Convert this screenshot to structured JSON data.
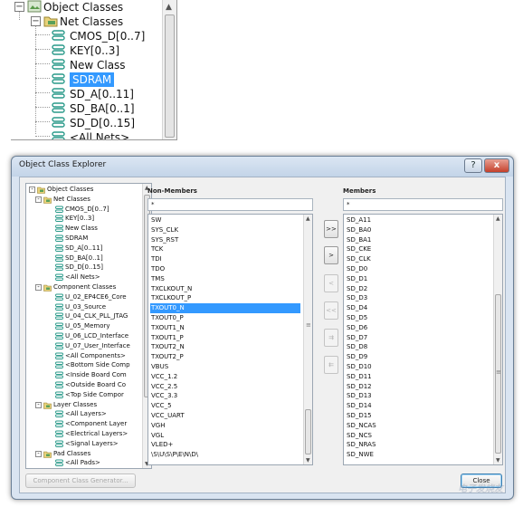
{
  "zoom_tree": {
    "items": [
      {
        "label": "Object Classes",
        "icon": "object-classes-icon",
        "expanded": true,
        "level": 0
      },
      {
        "label": "Net Classes",
        "icon": "net-classes-folder-icon",
        "expanded": true,
        "level": 1
      },
      {
        "label": "CMOS_D[0..7]",
        "icon": "net-class-icon",
        "level": 2
      },
      {
        "label": "KEY[0..3]",
        "icon": "net-class-icon",
        "level": 2
      },
      {
        "label": "New Class",
        "icon": "net-class-icon",
        "level": 2
      },
      {
        "label": "SDRAM",
        "icon": "net-class-icon",
        "level": 2,
        "selected": true
      },
      {
        "label": "SD_A[0..11]",
        "icon": "net-class-icon",
        "level": 2
      },
      {
        "label": "SD_BA[0..1]",
        "icon": "net-class-icon",
        "level": 2
      },
      {
        "label": "SD_D[0..15]",
        "icon": "net-class-icon",
        "level": 2
      },
      {
        "label": "<All Nets>",
        "icon": "net-class-icon",
        "level": 2
      }
    ]
  },
  "dialog": {
    "title": "Object Class Explorer",
    "help_label": "?",
    "close_label": "x",
    "tree": {
      "items": [
        {
          "label": "Object Classes",
          "expander": "-",
          "level": 0
        },
        {
          "label": "Net Classes",
          "expander": "-",
          "level": 1
        },
        {
          "label": "CMOS_D[0..7]",
          "level": 2
        },
        {
          "label": "KEY[0..3]",
          "level": 2
        },
        {
          "label": "New Class",
          "level": 2
        },
        {
          "label": "SDRAM",
          "level": 2
        },
        {
          "label": "SD_A[0..11]",
          "level": 2
        },
        {
          "label": "SD_BA[0..1]",
          "level": 2
        },
        {
          "label": "SD_D[0..15]",
          "level": 2
        },
        {
          "label": "<All Nets>",
          "level": 2
        },
        {
          "label": "Component Classes",
          "expander": "-",
          "level": 1
        },
        {
          "label": "U_02_EP4CE6_Core",
          "level": 2
        },
        {
          "label": "U_03_Source",
          "level": 2
        },
        {
          "label": "U_04_CLK_PLL_JTAG",
          "level": 2
        },
        {
          "label": "U_05_Memory",
          "level": 2
        },
        {
          "label": "U_06_LCD_Interface",
          "level": 2
        },
        {
          "label": "U_07_User_Interface",
          "level": 2
        },
        {
          "label": "<All Components>",
          "level": 2
        },
        {
          "label": "<Bottom Side Comp",
          "level": 2
        },
        {
          "label": "<Inside Board Com",
          "level": 2
        },
        {
          "label": "<Outside Board Co",
          "level": 2
        },
        {
          "label": "<Top Side Compor",
          "level": 2
        },
        {
          "label": "Layer Classes",
          "expander": "-",
          "level": 1
        },
        {
          "label": "<All Layers>",
          "level": 2
        },
        {
          "label": "<Component Layer",
          "level": 2
        },
        {
          "label": "<Electrical Layers>",
          "level": 2
        },
        {
          "label": "<Signal Layers>",
          "level": 2
        },
        {
          "label": "Pad Classes",
          "expander": "-",
          "level": 1
        },
        {
          "label": "<All Pads>",
          "level": 2
        }
      ]
    },
    "non_members": {
      "label": "Non-Members",
      "filter": "*",
      "selected": "TXOUT0_N",
      "items": [
        "SW",
        "SYS_CLK",
        "SYS_RST",
        "TCK",
        "TDI",
        "TDO",
        "TMS",
        "TXCLKOUT_N",
        "TXCLKOUT_P",
        "TXOUT0_N",
        "TXOUT0_P",
        "TXOUT1_N",
        "TXOUT1_P",
        "TXOUT2_N",
        "TXOUT2_P",
        "VBUS",
        "VCC_1.2",
        "VCC_2.5",
        "VCC_3.3",
        "VCC_5",
        "VCC_UART",
        "VGH",
        "VGL",
        "VLED+",
        "\\S\\U\\S\\P\\E\\N\\D\\"
      ]
    },
    "members": {
      "label": "Members",
      "filter": "*",
      "items": [
        "SD_A11",
        "SD_BA0",
        "SD_BA1",
        "SD_CKE",
        "SD_CLK",
        "SD_D0",
        "SD_D1",
        "SD_D2",
        "SD_D3",
        "SD_D4",
        "SD_D5",
        "SD_D6",
        "SD_D7",
        "SD_D8",
        "SD_D9",
        "SD_D10",
        "SD_D11",
        "SD_D12",
        "SD_D13",
        "SD_D14",
        "SD_D15",
        "SD_NCAS",
        "SD_NCS",
        "SD_NRAS",
        "SD_NWE"
      ]
    },
    "move_buttons": {
      "add_all": ">>",
      "add_one": ">",
      "remove_one": "<",
      "remove_all": "<<",
      "add_selected": "⇉",
      "remove_selected": "⇇"
    },
    "generator_button": "Component Class Generator...",
    "close_button": "Close"
  },
  "watermark": "电子发烧友",
  "colors": {
    "selection": "#3399ff",
    "dialog_frame": "#d9e4f1",
    "close_button": "#c4402b"
  }
}
